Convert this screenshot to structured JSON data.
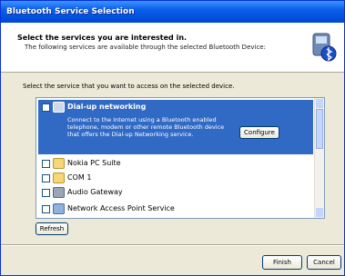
{
  "window": {
    "title": "Bluetooth Service Selection"
  },
  "header": {
    "title": "Select the services you are interested in.",
    "subtitle": "The following services are available through the selected Bluetooth Device:"
  },
  "instruction": "Select the service that you want to access on the selected device.",
  "services": [
    {
      "label": "Dial-up networking",
      "selected": true,
      "description": "Connect to the Internet using a Bluetooth enabled telephone, modem or other remote Bluetooth device that offers the Dial-up Networking service.",
      "configure_label": "Configure",
      "icon": "dialup-icon"
    },
    {
      "label": "Nokia PC Suite",
      "icon": "folder-icon"
    },
    {
      "label": "COM 1",
      "icon": "folder-icon"
    },
    {
      "label": "Audio Gateway",
      "icon": "audio-icon"
    },
    {
      "label": "Network Access Point Service",
      "icon": "network-icon"
    }
  ],
  "buttons": {
    "refresh": "Refresh",
    "finish": "Finish",
    "cancel": "Cancel"
  },
  "colors": {
    "selection": "#316ac5",
    "titlebar": "#0a5fe8"
  }
}
